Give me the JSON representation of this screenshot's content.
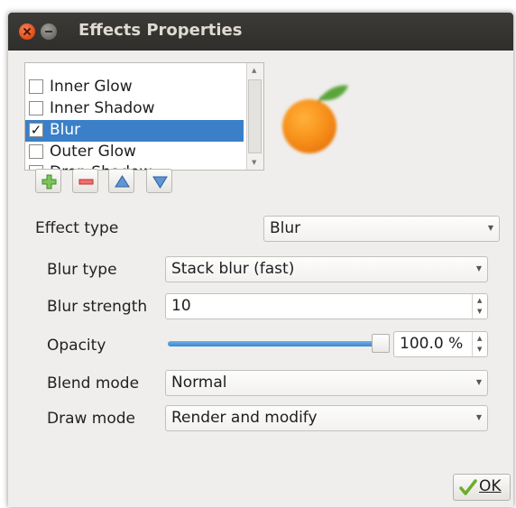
{
  "window": {
    "title": "Effects Properties"
  },
  "effects": {
    "items": [
      {
        "label": "Inner Glow",
        "checked": false,
        "selected": false
      },
      {
        "label": "Inner Shadow",
        "checked": false,
        "selected": false
      },
      {
        "label": "Blur",
        "checked": true,
        "selected": true
      },
      {
        "label": "Outer Glow",
        "checked": false,
        "selected": false
      },
      {
        "label": "Drop Shadow",
        "checked": false,
        "selected": false
      }
    ]
  },
  "toolbar": {
    "add_icon": "plus-icon",
    "remove_icon": "minus-icon",
    "up_icon": "arrow-up-icon",
    "down_icon": "arrow-down-icon"
  },
  "form": {
    "effect_type": {
      "label": "Effect type",
      "value": "Blur"
    },
    "blur_type": {
      "label": "Blur type",
      "value": "Stack blur (fast)"
    },
    "blur_strength": {
      "label": "Blur strength",
      "value": "10"
    },
    "opacity": {
      "label": "Opacity",
      "value": "100.0 %",
      "level": 1.0
    },
    "blend_mode": {
      "label": "Blend mode",
      "value": "Normal"
    },
    "draw_mode": {
      "label": "Draw mode",
      "value": "Render and modify"
    }
  },
  "buttons": {
    "ok": "OK"
  },
  "colors": {
    "selection": "#3b7fc8",
    "titlebar": "#3c3b37",
    "slider": "#3a86d0"
  }
}
